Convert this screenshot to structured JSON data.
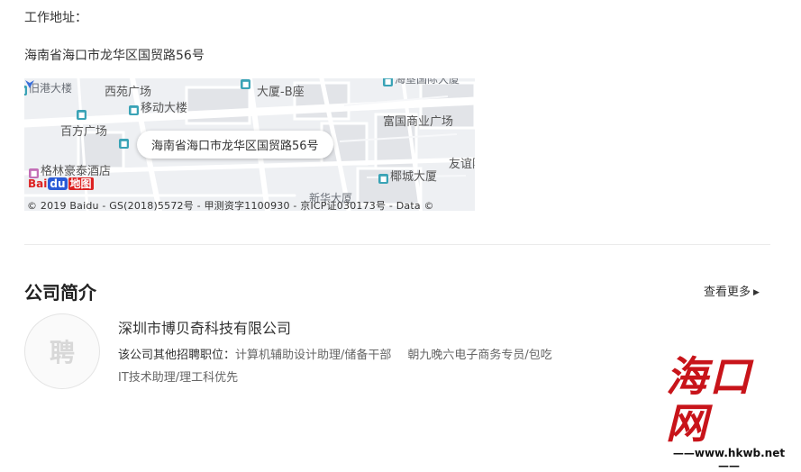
{
  "work_address": {
    "label": "工作地址：",
    "address": "海南省海口市龙华区国贸路56号"
  },
  "map": {
    "bubble_text": "海南省海口市龙华区国贸路56号",
    "pois": [
      {
        "name": "旧港大楼"
      },
      {
        "name": "西苑广场"
      },
      {
        "name": "大厦-B座"
      },
      {
        "name": "海垦国际大厦"
      },
      {
        "name": "移动大楼"
      },
      {
        "name": "富国商业广场"
      },
      {
        "name": "百方广场"
      },
      {
        "name": "友谊阳"
      },
      {
        "name": "格林豪泰酒店"
      },
      {
        "name": "椰城大厦"
      },
      {
        "name": "新华大厦"
      }
    ],
    "logo": {
      "bai": "Bai",
      "du": "du",
      "ditu": "地图"
    },
    "copyright": "© 2019 Baidu - GS(2018)5572号 - 甲测资字1100930 - 京ICP证030173号 - Data ©",
    "colors": {
      "road": "#ffffff",
      "background": "#eef0f3",
      "marker": "#3b6fd9"
    }
  },
  "company_section": {
    "title": "公司简介",
    "more_label": "查看更多",
    "logo_placeholder": "聘",
    "company_name": "深圳市博贝奇科技有限公司",
    "jobs_prefix": "该公司其他招聘职位：",
    "jobs": [
      "计算机辅助设计助理/储备干部",
      "朝九晚六电子商务专员/包吃",
      "IT技术助理/理工科优先"
    ]
  },
  "watermark": {
    "text": "海口网",
    "url": "——www.hkwb.net——",
    "color": "#c8141a"
  }
}
